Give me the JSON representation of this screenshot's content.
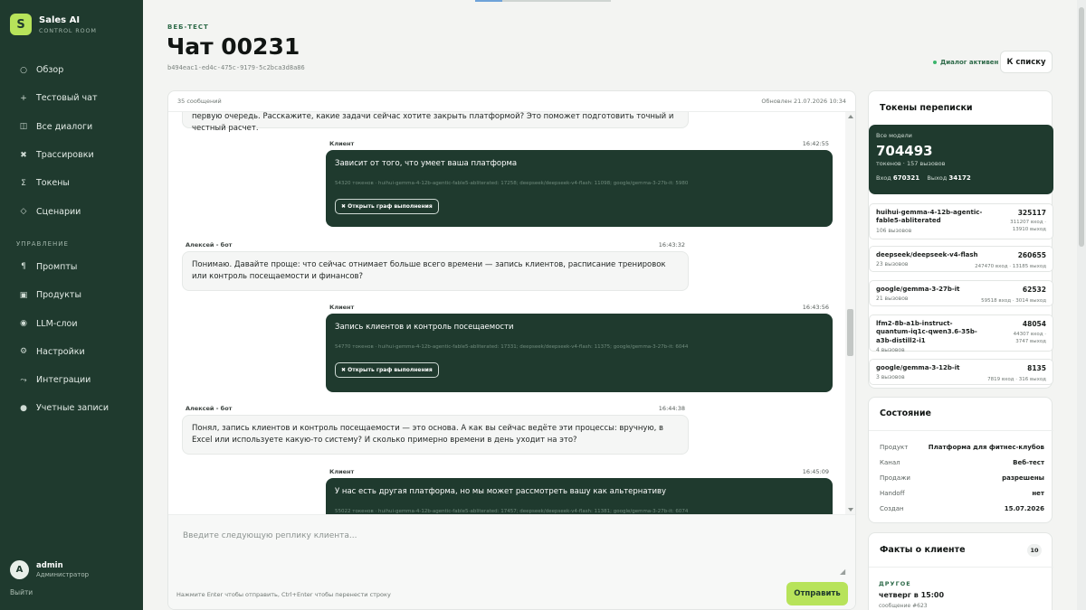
{
  "brand": {
    "logo_letter": "S",
    "title": "Sales AI",
    "subtitle": "CONTROL ROOM"
  },
  "nav": {
    "items": [
      {
        "label": "Обзор",
        "icon": "○"
      },
      {
        "label": "Тестовый чат",
        "icon": "+"
      },
      {
        "label": "Все диалоги",
        "icon": "◫"
      },
      {
        "label": "Трассировки",
        "icon": "✖"
      },
      {
        "label": "Токены",
        "icon": "Σ"
      },
      {
        "label": "Сценарии",
        "icon": "◇"
      }
    ],
    "section_label": "УПРАВЛЕНИЕ",
    "admin_items": [
      {
        "label": "Промпты",
        "icon": "¶"
      },
      {
        "label": "Продукты",
        "icon": "▣"
      },
      {
        "label": "LLM-слои",
        "icon": "◉"
      },
      {
        "label": "Настройки",
        "icon": "⚙"
      },
      {
        "label": "Интеграции",
        "icon": "⤳"
      },
      {
        "label": "Учетные записи",
        "icon": "●"
      }
    ]
  },
  "user": {
    "initial": "A",
    "name": "admin",
    "role": "Администратор",
    "logout": "Выйти"
  },
  "header": {
    "eyebrow": "ВЕБ-ТЕСТ",
    "title": "Чат 00231",
    "chat_id": "b494eac1-ed4c-475c-9179-5c2bca3d8a86",
    "status": "Диалог активен",
    "back_label": "К списку"
  },
  "chat": {
    "message_count": "35 сообщений",
    "updated": "Обновлен 21.07.2026 10:34",
    "partial_top": "первую очередь. Расскажите, какие задачи сейчас хотите закрыть платформой? Это поможет подготовить точный и честный расчет.",
    "messages": [
      {
        "role": "client",
        "author": "Клиент",
        "time": "16:42:55",
        "text": "Зависит от того, что умеет ваша платформа",
        "tokens": "54320 токенов · huihui-gemma-4-12b-agentic-fable5-abliterated: 17258; deepseek/deepseek-v4-flash: 11098; google/gemma-3-27b-it: 5980",
        "graph_label": "✖ Открыть граф выполнения"
      },
      {
        "role": "bot",
        "author": "Алексей - бот",
        "time": "16:43:32",
        "text": "Понимаю. Давайте проще: что сейчас отнимает больше всего времени — запись клиентов, расписание тренировок или контроль посещаемости и финансов?"
      },
      {
        "role": "client",
        "author": "Клиент",
        "time": "16:43:56",
        "text": "Запись клиентов и контроль посещаемости",
        "tokens": "54770 токенов · huihui-gemma-4-12b-agentic-fable5-abliterated: 17331; deepseek/deepseek-v4-flash: 11375; google/gemma-3-27b-it: 6044",
        "graph_label": "✖ Открыть граф выполнения"
      },
      {
        "role": "bot",
        "author": "Алексей - бот",
        "time": "16:44:38",
        "text": "Понял, запись клиентов и контроль посещаемости — это основа. А как вы сейчас ведёте эти процессы: вручную, в Excel или используете какую-то систему? И сколько примерно времени в день уходит на это?"
      },
      {
        "role": "client",
        "author": "Клиент",
        "time": "16:45:09",
        "text": "У нас есть другая платформа, но мы может рассмотреть вашу как альтернативу",
        "tokens": "55022 токенов · huihui-gemma-4-12b-agentic-fable5-abliterated: 17457; deepseek/deepseek-v4-flash: 11381; google/gemma-3-27b-it: 6074"
      }
    ],
    "input_placeholder": "Введите следующую реплику клиента...",
    "hint": "Нажмите Enter чтобы отправить, Ctrl+Enter чтобы перенести строку",
    "send_label": "Отправить"
  },
  "tokens": {
    "title": "Токены переписки",
    "all_label": "Все модели",
    "total": "704493",
    "total_sub": "токенов · 157 вызовов",
    "in_label": "Вход",
    "in_value": "670321",
    "out_label": "Выход",
    "out_value": "34172",
    "models": [
      {
        "name": "huihui-gemma-4-12b-agentic-fable5-abliterated",
        "calls": "106 вызовов",
        "total": "325117",
        "in": "311207 вход ·",
        "out": "13910 выход"
      },
      {
        "name": "deepseek/deepseek-v4-flash",
        "calls": "23 вызовов",
        "total": "260655",
        "in": "247470 вход · 13185 выход",
        "out": ""
      },
      {
        "name": "google/gemma-3-27b-it",
        "calls": "21 вызовов",
        "total": "62532",
        "in": "59518 вход · 3014 выход",
        "out": ""
      },
      {
        "name": "lfm2-8b-a1b-instruct-quantum-iq1c-qwen3.6-35b-a3b-distill2-i1",
        "calls": "4 вызовов",
        "total": "48054",
        "in": "44307 вход ·",
        "out": "3747 выход"
      },
      {
        "name": "google/gemma-3-12b-it",
        "calls": "3 вызовов",
        "total": "8135",
        "in": "7819 вход · 316 выход",
        "out": ""
      }
    ]
  },
  "state": {
    "title": "Состояние",
    "rows": [
      {
        "k": "Продукт",
        "v": "Платформа для фитнес-клубов"
      },
      {
        "k": "Канал",
        "v": "Веб-тест"
      },
      {
        "k": "Продажи",
        "v": "разрешены"
      },
      {
        "k": "Handoff",
        "v": "нет"
      },
      {
        "k": "Создан",
        "v": "15.07.2026"
      }
    ]
  },
  "facts": {
    "title": "Факты о клиенте",
    "count": "10",
    "category": "ДРУГОЕ",
    "value": "четверг в 15:00",
    "source": "сообщение #623"
  },
  "colors": {
    "sidebar": "#1f3a2e",
    "accent": "#b7e35a",
    "status": "#3bb56c"
  }
}
